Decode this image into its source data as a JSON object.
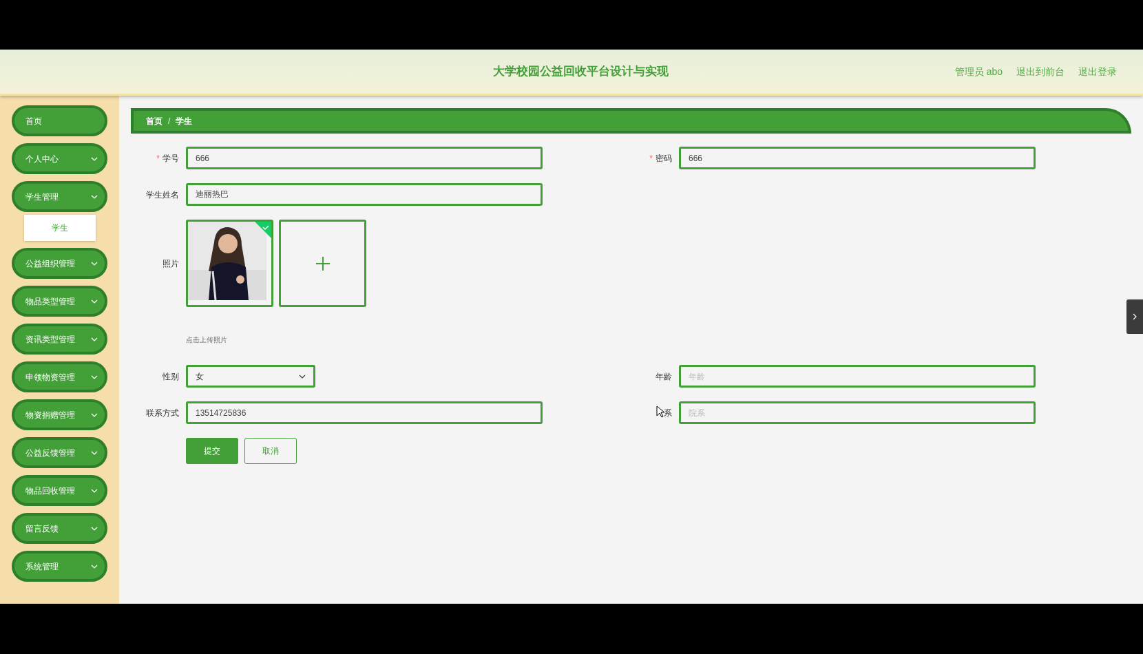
{
  "header": {
    "title": "大学校园公益回收平台设计与实现",
    "links": [
      "管理员 abo",
      "退出到前台",
      "退出登录"
    ]
  },
  "sidebar": {
    "items": [
      {
        "label": "首页",
        "expandable": false
      },
      {
        "label": "个人中心",
        "expandable": true
      },
      {
        "label": "学生管理",
        "expandable": true,
        "children": [
          {
            "label": "学生",
            "selected": true
          }
        ]
      },
      {
        "label": "公益组织管理",
        "expandable": true
      },
      {
        "label": "物品类型管理",
        "expandable": true
      },
      {
        "label": "资讯类型管理",
        "expandable": true
      },
      {
        "label": "申领物资管理",
        "expandable": true
      },
      {
        "label": "物资捐赠管理",
        "expandable": true
      },
      {
        "label": "公益反馈管理",
        "expandable": true
      },
      {
        "label": "物品回收管理",
        "expandable": true
      },
      {
        "label": "留言反馈",
        "expandable": true
      },
      {
        "label": "系统管理",
        "expandable": true
      }
    ]
  },
  "breadcrumb": {
    "items": [
      "首页",
      "学生"
    ],
    "separator": "/"
  },
  "form": {
    "student_id": {
      "label": "学号",
      "required_mark": "*",
      "value": "666"
    },
    "password": {
      "label": "密码",
      "required_mark": "*",
      "value": "666"
    },
    "name": {
      "label": "学生姓名",
      "value": "迪丽热巴"
    },
    "photo": {
      "label": "照片",
      "uploaded": true,
      "hint": "点击上传照片"
    },
    "gender": {
      "label": "性别",
      "value": "女"
    },
    "age": {
      "label": "年龄",
      "placeholder": "年龄"
    },
    "contact": {
      "label": "联系方式",
      "value": "13514725836"
    },
    "department": {
      "label": "系",
      "placeholder": "院系"
    },
    "buttons": [
      "提交",
      "取消"
    ]
  }
}
